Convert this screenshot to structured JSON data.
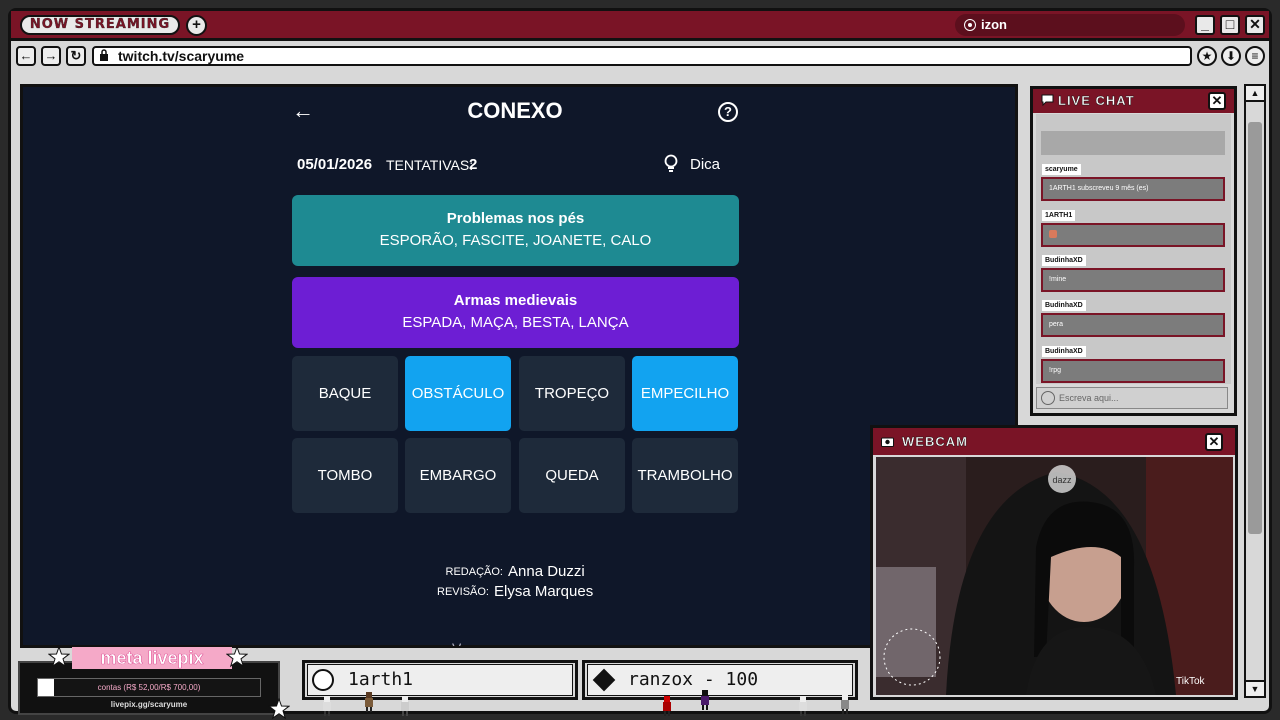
{
  "browser": {
    "badge": "NOW STREAMING",
    "plus": "+",
    "tab_label": "izon",
    "window_controls": {
      "minimize": "_",
      "maximize": "□",
      "close": "✕"
    },
    "nav": {
      "back": "←",
      "forward": "→",
      "reload": "↻"
    },
    "url": "twitch.tv/scaryume",
    "right_icons": [
      "star-icon",
      "download-icon",
      "menu-icon"
    ]
  },
  "game": {
    "back": "←",
    "title": "CONEXO",
    "help": "?",
    "date": "05/01/2026",
    "tries_label": "TENTATIVAS:",
    "tries_value": "2",
    "hint": "Dica",
    "groups": [
      {
        "title": "Problemas nos pés",
        "words": "ESPORÃO, FASCITE, JOANETE, CALO",
        "color": "#1e8a92"
      },
      {
        "title": "Armas medievais",
        "words": "ESPADA, MAÇA, BESTA, LANÇA",
        "color": "#6d1ed4"
      }
    ],
    "tiles": [
      {
        "label": "BAQUE",
        "selected": false
      },
      {
        "label": "OBSTÁCULO",
        "selected": true
      },
      {
        "label": "TROPEÇO",
        "selected": false
      },
      {
        "label": "EMPECILHO",
        "selected": true
      },
      {
        "label": "TOMBO",
        "selected": false
      },
      {
        "label": "EMBARGO",
        "selected": false
      },
      {
        "label": "QUEDA",
        "selected": false
      },
      {
        "label": "TRAMBOLHO",
        "selected": false
      }
    ],
    "credits": {
      "writing_label": "REDAÇÃO:",
      "writing_value": "Anna Duzzi",
      "review_label": "REVISÃO:",
      "review_value": "Elysa Marques"
    },
    "cut_text": "V"
  },
  "chat": {
    "title": "LIVE CHAT",
    "close": "✕",
    "messages": [
      {
        "user": "scaryume",
        "text": "1ARTH1 subscreveu 9 mês (es)"
      },
      {
        "user": "1ARTH1",
        "text": ""
      },
      {
        "user": "BudinhaXD",
        "text": "!mine"
      },
      {
        "user": "BudinhaXD",
        "text": "pera"
      },
      {
        "user": "BudinhaXD",
        "text": "!rpg"
      }
    ],
    "input_placeholder": "Escreva aqui..."
  },
  "webcam": {
    "title": "WEBCAM",
    "close": "✕",
    "watermark": "dazz",
    "tiktok": "TikTok"
  },
  "bottom": {
    "meta_title": "meta livepix",
    "meta_progress_text": "contas (R$ 52,00/R$ 700,00)",
    "meta_progress_fraction": 0.074,
    "meta_url": "livepix.gg/scaryume",
    "alert_left": "1arth1",
    "alert_right": "ranzox - 100"
  }
}
